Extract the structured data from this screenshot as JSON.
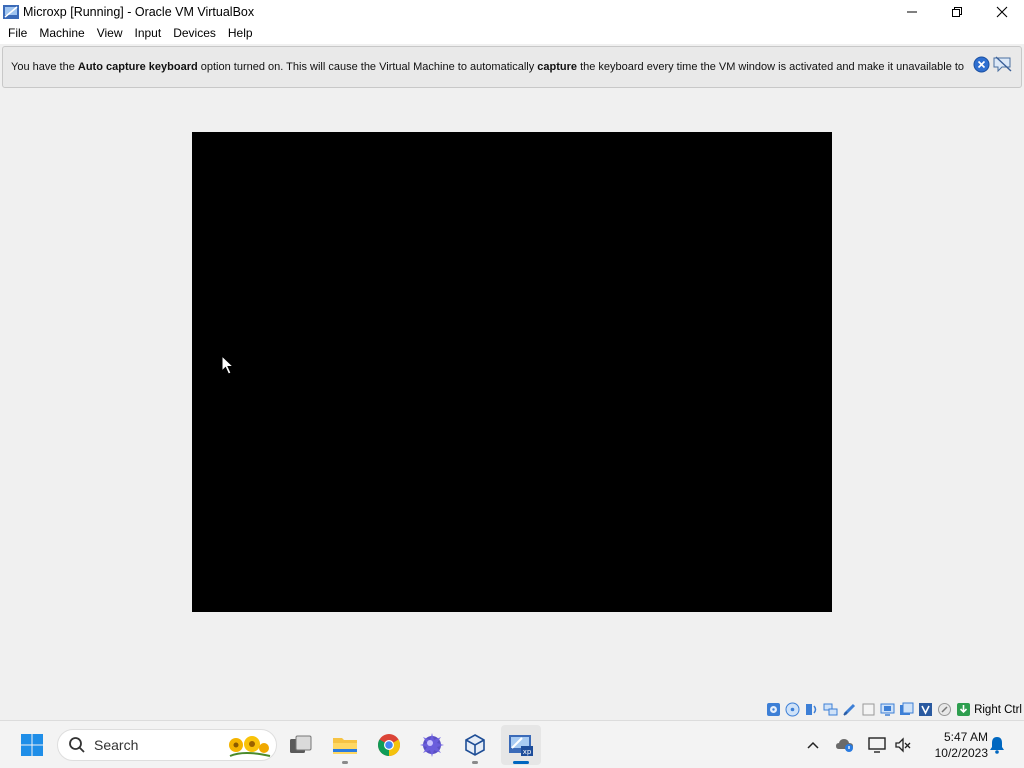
{
  "window": {
    "title": "Microxp [Running] - Oracle VM VirtualBox"
  },
  "menu": [
    "File",
    "Machine",
    "View",
    "Input",
    "Devices",
    "Help"
  ],
  "banner": {
    "t1": "You have the ",
    "b1": "Auto capture keyboard",
    "t2": " option turned on. This will cause the Virtual Machine to automatically ",
    "b2": "capture",
    "t3": " the keyboard every time the VM window is activated and make it unavailable to"
  },
  "statusbar": {
    "icons": [
      "hard-disk-icon",
      "optical-drive-icon",
      "audio-icon",
      "network-icon",
      "usb-icon",
      "shared-folders-icon",
      "display-icon",
      "recording-icon",
      "cpu-icon",
      "mouse-integration-icon",
      "keyboard-capture-icon"
    ],
    "host_key": "Right Ctrl"
  },
  "taskbar": {
    "search_label": "Search",
    "apps": [
      "start-icon",
      "task-view-icon",
      "file-explorer-icon",
      "chrome-icon",
      "app-icon",
      "virtualbox-icon",
      "microxp-vm-icon"
    ],
    "time": "5:47 AM",
    "date": "10/2/2023"
  },
  "colors": {
    "accent": "#0067c0",
    "guest_screen": "#000000",
    "chrome_background": "#f0f0f0"
  }
}
